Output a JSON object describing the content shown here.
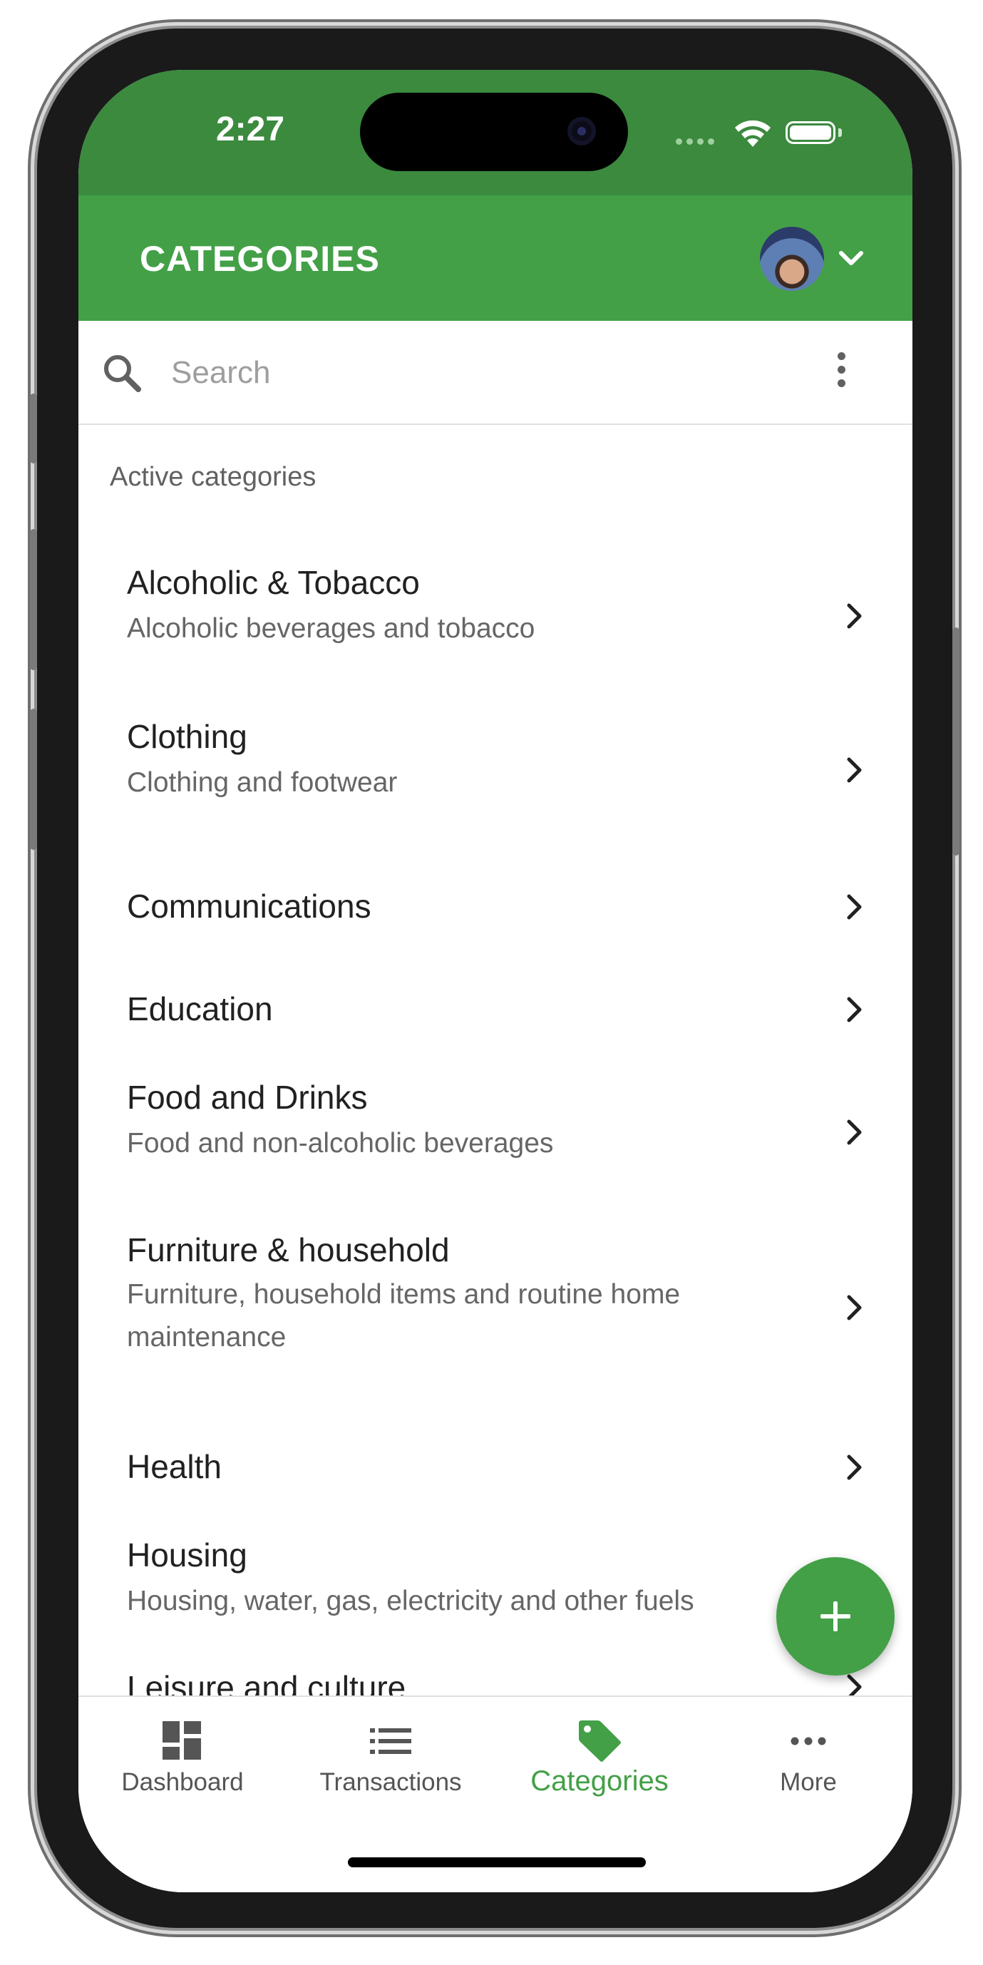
{
  "status_bar": {
    "time": "2:27"
  },
  "app_bar": {
    "title": "CATEGORIES"
  },
  "search": {
    "placeholder": "Search"
  },
  "list": {
    "section_header": "Active categories",
    "items": [
      {
        "title": "Alcoholic & Tobacco",
        "subtitle": "Alcoholic beverages and tobacco"
      },
      {
        "title": "Clothing",
        "subtitle": "Clothing and footwear"
      },
      {
        "title": "Communications",
        "subtitle": ""
      },
      {
        "title": "Education",
        "subtitle": ""
      },
      {
        "title": "Food and Drinks",
        "subtitle": "Food and non-alcoholic beverages"
      },
      {
        "title": "Furniture & household",
        "subtitle": "Furniture, household items and routine home maintenance"
      },
      {
        "title": "Health",
        "subtitle": ""
      },
      {
        "title": "Housing",
        "subtitle": "Housing, water, gas, electricity and other fuels"
      },
      {
        "title": "Leisure and culture",
        "subtitle": ""
      }
    ]
  },
  "tab_bar": {
    "tabs": [
      {
        "label": "Dashboard",
        "icon": "dashboard-icon"
      },
      {
        "label": "Transactions",
        "icon": "list-icon"
      },
      {
        "label": "Categories",
        "icon": "tag-icon",
        "active": true
      },
      {
        "label": "More",
        "icon": "more-horizontal-icon"
      }
    ]
  },
  "colors": {
    "primary": "#43a047",
    "status_bar": "#3b8a3e",
    "text_primary": "#212121",
    "text_secondary": "#666666"
  }
}
